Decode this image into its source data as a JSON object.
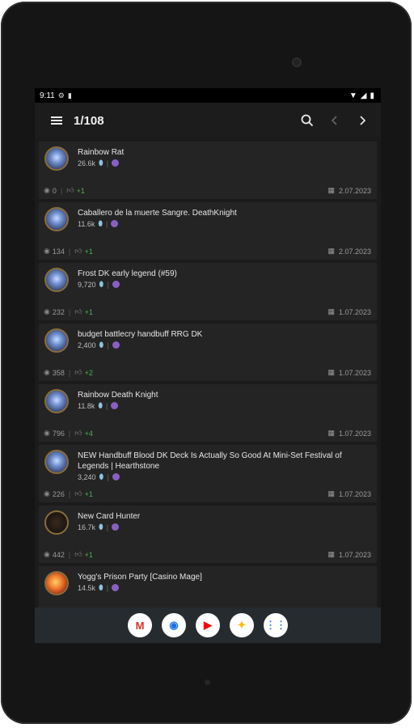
{
  "status": {
    "time": "9:11"
  },
  "appbar": {
    "counter": "1/108"
  },
  "cards": [
    {
      "name": "Rainbow Rat",
      "dust": "26.6k",
      "views": "0",
      "likes": "+1",
      "date": "2.07.2023",
      "avatar": "dk"
    },
    {
      "name": "Caballero de la muerte Sangre. DeathKnight",
      "dust": "11.6k",
      "views": "134",
      "likes": "+1",
      "date": "2.07.2023",
      "avatar": "dk"
    },
    {
      "name": "Frost DK early legend (#59)",
      "dust": "9,720",
      "views": "232",
      "likes": "+1",
      "date": "1.07.2023",
      "avatar": "dk"
    },
    {
      "name": "budget battlecry handbuff RRG DK",
      "dust": "2,400",
      "views": "358",
      "likes": "+2",
      "date": "1.07.2023",
      "avatar": "dk"
    },
    {
      "name": "Rainbow Death Knight",
      "dust": "11.8k",
      "views": "796",
      "likes": "+4",
      "date": "1.07.2023",
      "avatar": "dk"
    },
    {
      "name": "NEW Handbuff Blood DK Deck Is Actually So Good At Mini-Set Festival of Legends | Hearthstone",
      "dust": "3,240",
      "views": "226",
      "likes": "+1",
      "date": "1.07.2023",
      "avatar": "dk"
    },
    {
      "name": "New Card Hunter",
      "dust": "16.7k",
      "views": "442",
      "likes": "+1",
      "date": "1.07.2023",
      "avatar": "hunter"
    },
    {
      "name": "Yogg's Prison Party [Casino Mage]",
      "dust": "14.5k",
      "views": "",
      "likes": "",
      "date": "",
      "avatar": "mage"
    }
  ],
  "dock": [
    {
      "icon": "gmail-icon",
      "label": "M",
      "color": "#d93025"
    },
    {
      "icon": "chrome-icon",
      "label": "◉",
      "color": "#1a73e8"
    },
    {
      "icon": "youtube-icon",
      "label": "▶",
      "color": "#ff0000"
    },
    {
      "icon": "photos-icon",
      "label": "✦",
      "color": "#fbbc04"
    },
    {
      "icon": "apps-icon",
      "label": "⋮⋮",
      "color": "#4285f4"
    }
  ]
}
